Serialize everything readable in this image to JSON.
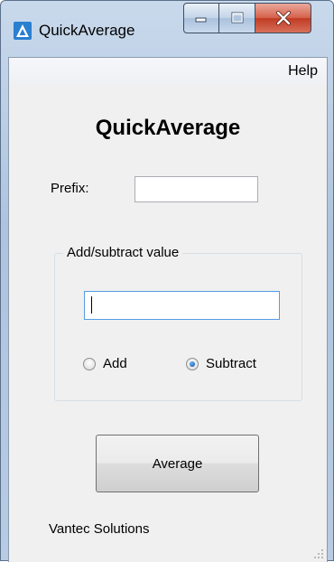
{
  "window": {
    "title": "QuickAverage",
    "icon": "quickaverage-app-icon",
    "controls": [
      "minimize-icon",
      "maximize-icon",
      "close-icon"
    ]
  },
  "menu": {
    "help_label": "Help"
  },
  "main": {
    "heading": "QuickAverage",
    "prefix_label": "Prefix:",
    "prefix_value": "",
    "group_title": "Add/subtract value",
    "value_input": "",
    "radio_add_label": "Add",
    "radio_subtract_label": "Subtract",
    "selected_mode": "Subtract",
    "average_button_label": "Average",
    "footer_text": "Vantec Solutions"
  },
  "colors": {
    "title_bar": "#b7cbe3",
    "client_bg": "#f0f0f0",
    "close_button": "#c13a23",
    "focus_border": "#569de5"
  }
}
